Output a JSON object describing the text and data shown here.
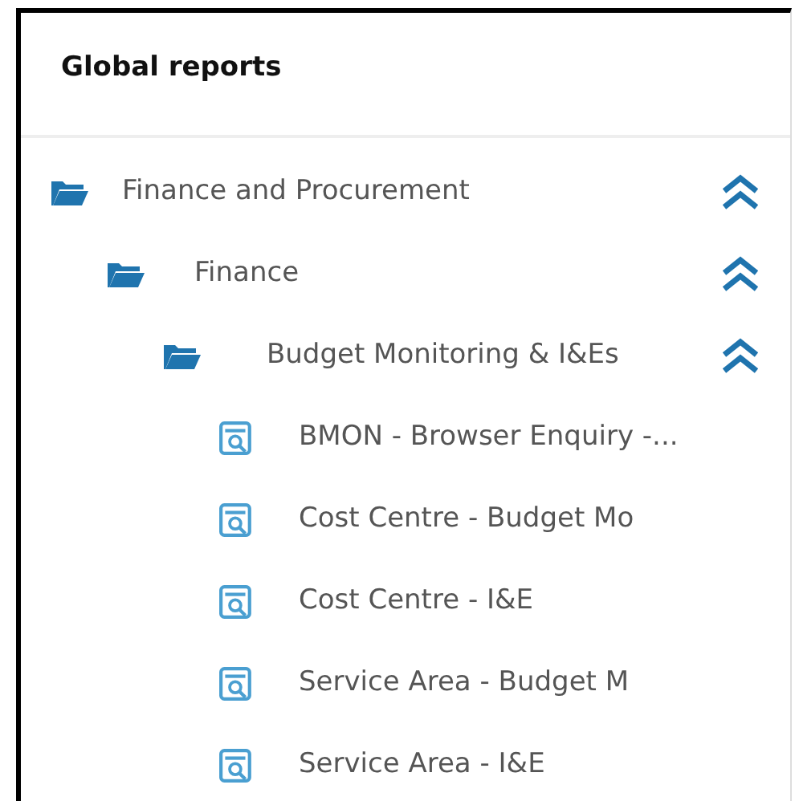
{
  "panel": {
    "title": "Global reports"
  },
  "tree": [
    {
      "kind": "folder",
      "label": "Finance and Procurement",
      "expanded": true,
      "children": [
        {
          "kind": "folder",
          "label": "Finance",
          "expanded": true,
          "children": [
            {
              "kind": "folder",
              "label": "Budget Monitoring & I&Es",
              "expanded": true,
              "children": [
                {
                  "kind": "report",
                  "label": "BMON - Browser Enquiry -..."
                },
                {
                  "kind": "report",
                  "label": "Cost Centre - Budget Mo"
                },
                {
                  "kind": "report",
                  "label": "Cost Centre - I&E"
                },
                {
                  "kind": "report",
                  "label": "Service Area - Budget M"
                },
                {
                  "kind": "report",
                  "label": "Service Area - I&E"
                }
              ]
            }
          ]
        }
      ]
    }
  ]
}
